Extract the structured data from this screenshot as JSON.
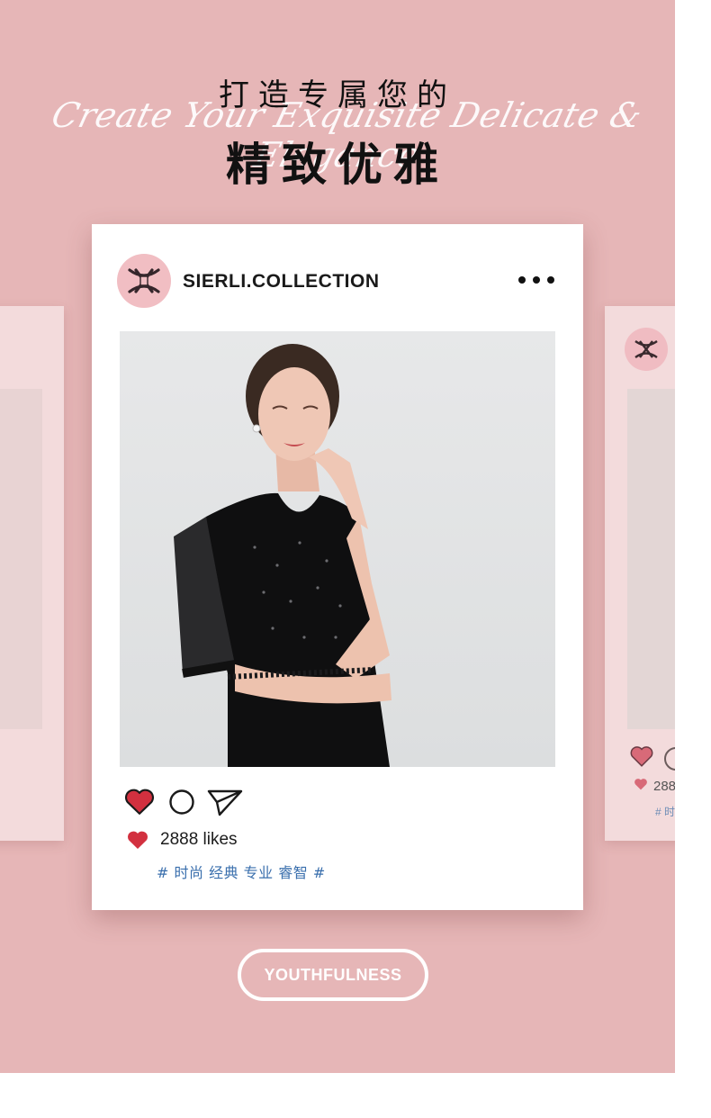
{
  "header": {
    "title_line1": "打造专属您的",
    "title_line2": "精致优雅",
    "script_text": "Create Your Exquisite Delicate & Elegance"
  },
  "post": {
    "account_name": "SIERLI.COLLECTION",
    "avatar_icon": "sierli-logo-icon",
    "more_icon": "more-options-icon",
    "photo_description": "woman-in-black-dress-photo",
    "actions": [
      "heart-icon",
      "comment-icon",
      "share-icon"
    ],
    "likes_text": "2888 likes",
    "hashtags": "# 时尚 经典 专业 睿智 #"
  },
  "side_post": {
    "likes_text": "288",
    "hashtags": "# 时"
  },
  "cta": {
    "label": "YOUTHFULNESS"
  },
  "colors": {
    "background": "#e6b6b7",
    "card": "#ffffff",
    "heart": "#d2303f",
    "hashtag": "#3a6fad",
    "avatar_bg": "#f1bec3"
  }
}
